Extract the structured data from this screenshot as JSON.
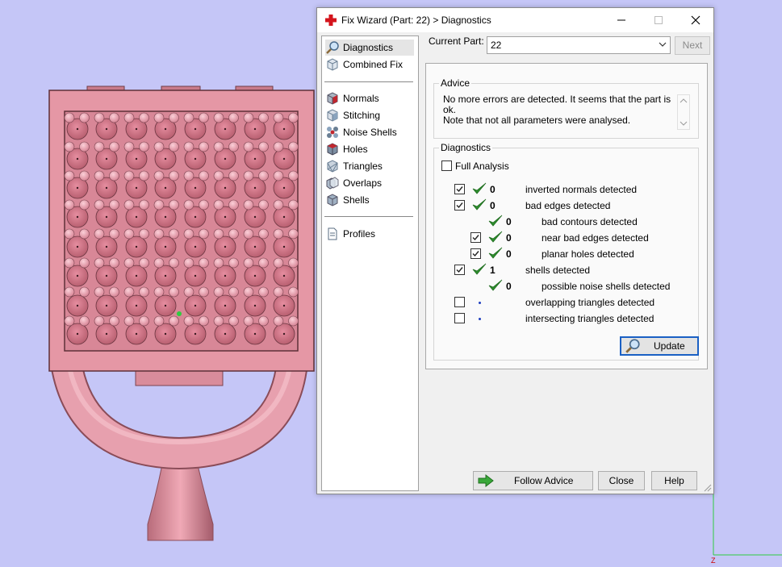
{
  "window": {
    "title": "Fix Wizard (Part: 22) > Diagnostics"
  },
  "nav": {
    "items": [
      {
        "label": "Diagnostics",
        "icon": "magnifier-icon",
        "selected": true
      },
      {
        "label": "Combined Fix",
        "icon": "cube-icon"
      },
      {
        "label": "Normals",
        "icon": "normals-cube-icon"
      },
      {
        "label": "Stitching",
        "icon": "stitching-cube-icon"
      },
      {
        "label": "Noise Shells",
        "icon": "noise-shells-icon"
      },
      {
        "label": "Holes",
        "icon": "holes-cube-icon"
      },
      {
        "label": "Triangles",
        "icon": "triangles-icon"
      },
      {
        "label": "Overlaps",
        "icon": "overlaps-icon"
      },
      {
        "label": "Shells",
        "icon": "shells-icon"
      },
      {
        "label": "Profiles",
        "icon": "document-icon"
      }
    ]
  },
  "current_part": {
    "label": "Current Part:",
    "value": "22",
    "next_label": "Next"
  },
  "advice": {
    "label": "Advice",
    "line1": "No more errors are detected. It seems that the part is ok.",
    "line2": "Note that not all parameters were analysed."
  },
  "diagnostics": {
    "label": "Diagnostics",
    "full_analysis_label": "Full Analysis",
    "full_analysis_checked": false,
    "rows": [
      {
        "checked": true,
        "status": "ok",
        "count": "0",
        "label": "inverted normals detected"
      },
      {
        "checked": true,
        "status": "ok",
        "count": "0",
        "label": "bad edges detected"
      },
      {
        "checked": null,
        "status": "ok",
        "count": "0",
        "label": "bad contours detected"
      },
      {
        "checked": true,
        "status": "ok",
        "count": "0",
        "label": "near bad edges detected"
      },
      {
        "checked": true,
        "status": "ok",
        "count": "0",
        "label": "planar holes detected"
      },
      {
        "checked": true,
        "status": "ok",
        "count": "1",
        "label": "shells detected"
      },
      {
        "checked": null,
        "status": "ok",
        "count": "0",
        "label": "possible noise shells detected"
      },
      {
        "checked": false,
        "status": "pending",
        "count": "",
        "label": "overlapping triangles detected"
      },
      {
        "checked": false,
        "status": "pending",
        "count": "",
        "label": "intersecting triangles detected"
      }
    ],
    "update_label": "Update"
  },
  "buttons": {
    "follow_advice": "Follow Advice",
    "close": "Close",
    "help": "Help"
  },
  "viewport": {
    "axis_label": "Z",
    "model_color": "#e4909f",
    "background": "#c5c6f7"
  }
}
